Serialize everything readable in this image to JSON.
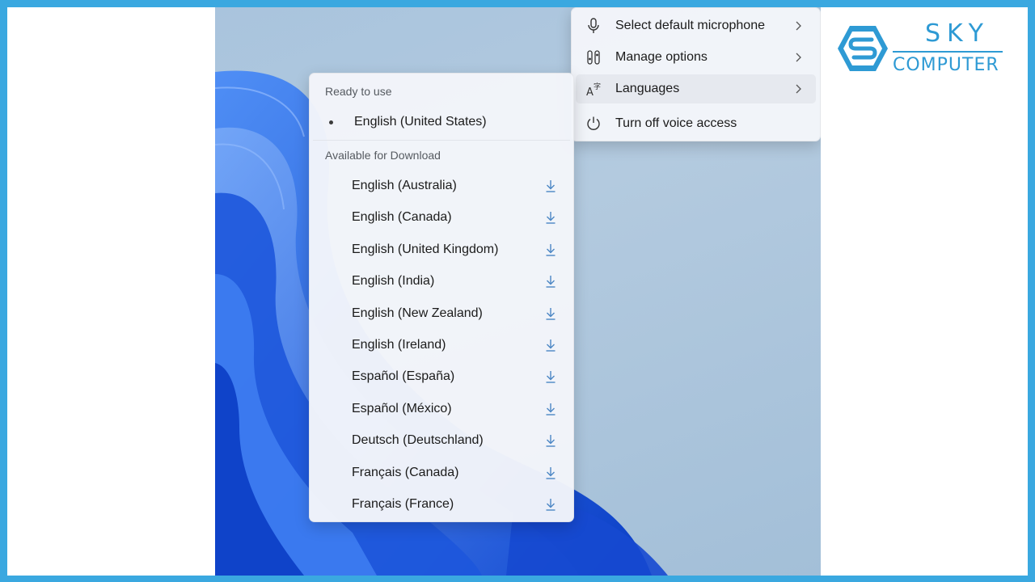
{
  "main_menu": {
    "items": [
      {
        "label": "Select default microphone",
        "icon": "microphone-icon",
        "has_submenu": true
      },
      {
        "label": "Manage options",
        "icon": "options-icon",
        "has_submenu": true
      },
      {
        "label": "Languages",
        "icon": "language-icon",
        "has_submenu": true,
        "hovered": true
      },
      {
        "label": "Turn off voice access",
        "icon": "power-icon",
        "has_submenu": false
      }
    ]
  },
  "languages_menu": {
    "ready_header": "Ready to use",
    "current_language": "English (United States)",
    "available_header": "Available for Download",
    "available": [
      "English (Australia)",
      "English (Canada)",
      "English (United Kingdom)",
      "English (India)",
      "English (New Zealand)",
      "English (Ireland)",
      "Español (España)",
      "Español (México)",
      "Deutsch (Deutschland)",
      "Français (Canada)",
      "Français (France)"
    ]
  },
  "brand": {
    "name_top": "SKY",
    "name_bottom": "COMPUTER",
    "color": "#2e9ad4"
  },
  "colors": {
    "frame": "#3aa8e0",
    "wallpaper_blue": "#1f5fe0",
    "download_icon": "#4b86c4"
  }
}
